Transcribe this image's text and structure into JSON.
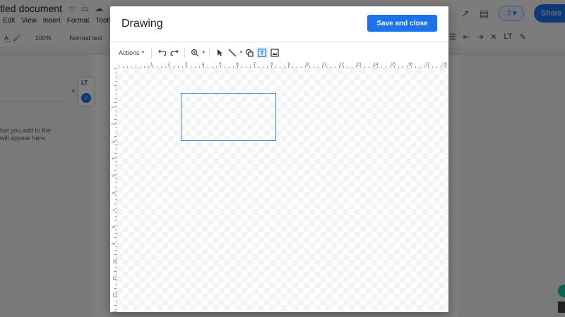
{
  "docs": {
    "title": "tled document",
    "menu": [
      "Edit",
      "View",
      "Insert",
      "Format",
      "Tools"
    ],
    "toolbar": {
      "zoom": "100%",
      "style": "Normal text"
    },
    "outline_hint": "hat you add to the will appear here.",
    "share_label": "Share",
    "lt_logo": "LT"
  },
  "dialog": {
    "title": "Drawing",
    "save_label": "Save and close",
    "toolbar": {
      "actions_label": "Actions",
      "tools": [
        {
          "name": "undo-icon"
        },
        {
          "name": "redo-icon"
        },
        {
          "name": "zoom-icon"
        },
        {
          "name": "select-icon"
        },
        {
          "name": "line-icon"
        },
        {
          "name": "shape-icon"
        },
        {
          "name": "text-box-icon",
          "active": true
        },
        {
          "name": "image-icon"
        }
      ]
    },
    "h_ruler_labels": [
      "1",
      "2",
      "3",
      "4",
      "5",
      "6",
      "7",
      "8",
      "9",
      "10",
      "11",
      "12",
      "13",
      "14",
      "15",
      "16",
      "17",
      "18",
      "19"
    ],
    "v_ruler_labels": [
      "1",
      "2",
      "3",
      "4",
      "5",
      "6",
      "7",
      "8",
      "9",
      "10",
      "11",
      "12",
      "13",
      "14"
    ]
  },
  "colors": {
    "accent": "#1a73e8",
    "selection": "#4a90e2"
  }
}
